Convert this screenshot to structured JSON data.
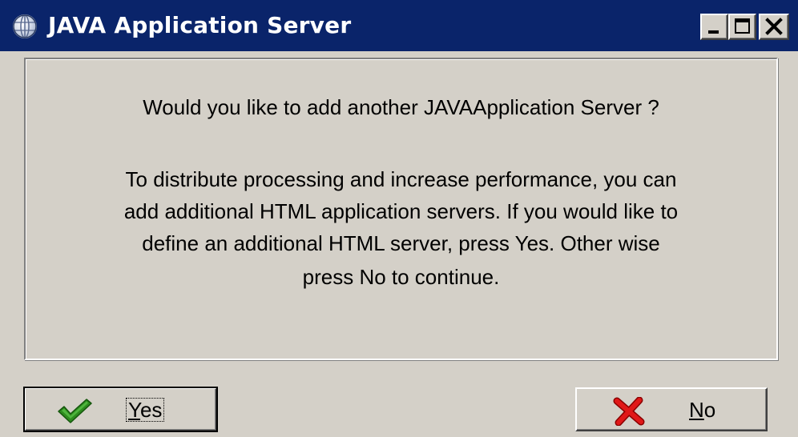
{
  "window": {
    "title": "JAVA Application Server",
    "icon": "globe-icon",
    "controls": {
      "minimize_icon": "minimize-icon",
      "maximize_icon": "maximize-icon",
      "close_icon": "close-icon"
    }
  },
  "message": {
    "question": "Would you like to add another JAVAApplication Server ?",
    "body_lines": [
      "To distribute processing and increase performance, you can",
      "add additional HTML application servers.  If you would like to",
      "define an additional HTML server, press Yes.  Other wise",
      "press No to continue."
    ]
  },
  "buttons": {
    "yes": {
      "mnemonic": "Y",
      "rest": "es",
      "icon": "checkmark-icon",
      "icon_color": "#2e8b1e"
    },
    "no": {
      "mnemonic": "N",
      "rest": "o",
      "icon": "red-x-icon",
      "icon_color": "#d01010"
    }
  },
  "colors": {
    "titlebar": "#0a246a",
    "face": "#d4d0c8"
  }
}
